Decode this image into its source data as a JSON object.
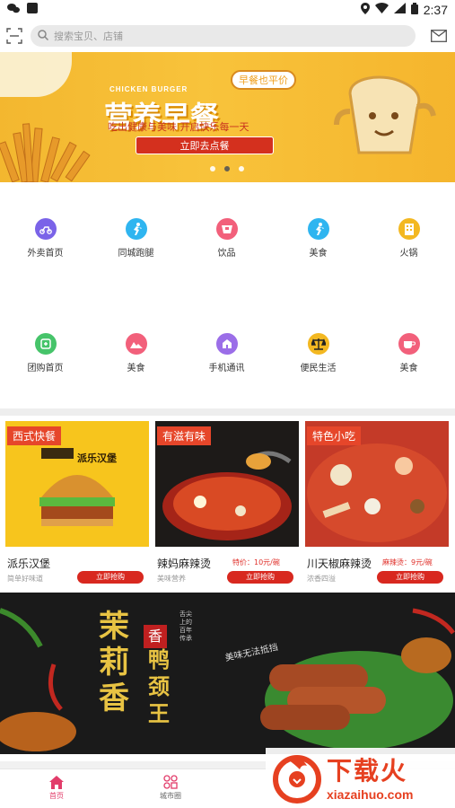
{
  "status_bar": {
    "time": "2:37"
  },
  "search": {
    "placeholder": "搜索宝贝、店铺"
  },
  "banner": {
    "english_title": "CHICKEN BURGER",
    "title": "营养早餐",
    "tag": "早餐也平价",
    "subtitle": "吃出健康与美味 开启快乐每一天",
    "cta": "立即去点餐",
    "page_count": 3,
    "active_page": 2
  },
  "categories": [
    {
      "label": "外卖首页",
      "icon": "bike-delivery-icon",
      "color": "#7a63e8"
    },
    {
      "label": "同城跑腿",
      "icon": "runner-icon",
      "color": "#2fb5f0"
    },
    {
      "label": "饮品",
      "icon": "drink-cup-icon",
      "color": "#f2607b"
    },
    {
      "label": "美食",
      "icon": "runner-icon",
      "color": "#2fb5f0"
    },
    {
      "label": "火锅",
      "icon": "building-icon",
      "color": "#f3b821"
    },
    {
      "label": "团购首页",
      "icon": "group-buy-icon",
      "color": "#46c46a"
    },
    {
      "label": "美食",
      "icon": "mountain-icon",
      "color": "#f2607b"
    },
    {
      "label": "手机通讯",
      "icon": "phone-shop-icon",
      "color": "#9b6ee8"
    },
    {
      "label": "便民生活",
      "icon": "scale-icon",
      "color": "#222222"
    },
    {
      "label": "美食",
      "icon": "coffee-icon",
      "color": "#f2607b"
    }
  ],
  "promos": [
    {
      "badge": "西式快餐",
      "name": "派乐汉堡",
      "desc": "简单好味道",
      "price": "",
      "cta": "立即抢购",
      "brand": "派乐汉堡"
    },
    {
      "badge": "有滋有味",
      "name": "辣妈麻辣烫",
      "desc": "美味营养",
      "price": "特价：10元/碗",
      "cta": "立即抢购"
    },
    {
      "badge": "特色小吃",
      "name": "川天椒麻辣烫",
      "desc": "浓香四溢",
      "price": "麻辣烫：9元/碗",
      "cta": "立即抢购"
    }
  ],
  "banner2": {
    "brand": "茉莉香",
    "seal": "香",
    "product": "鸭颈王",
    "poem": "舌尖上的百年传承",
    "slogan": "美味无法抵挡"
  },
  "tabs": [
    {
      "label": "首页",
      "icon": "home-icon",
      "active": true
    },
    {
      "label": "城市圈",
      "icon": "city-circle-icon",
      "active": false
    }
  ],
  "watermark": {
    "brand": "下载火",
    "url": "xiazaihuo.com"
  },
  "colors": {
    "accent": "#e23c6a",
    "cta_red": "#d8281f",
    "banner_yellow": "#f5b52d"
  }
}
